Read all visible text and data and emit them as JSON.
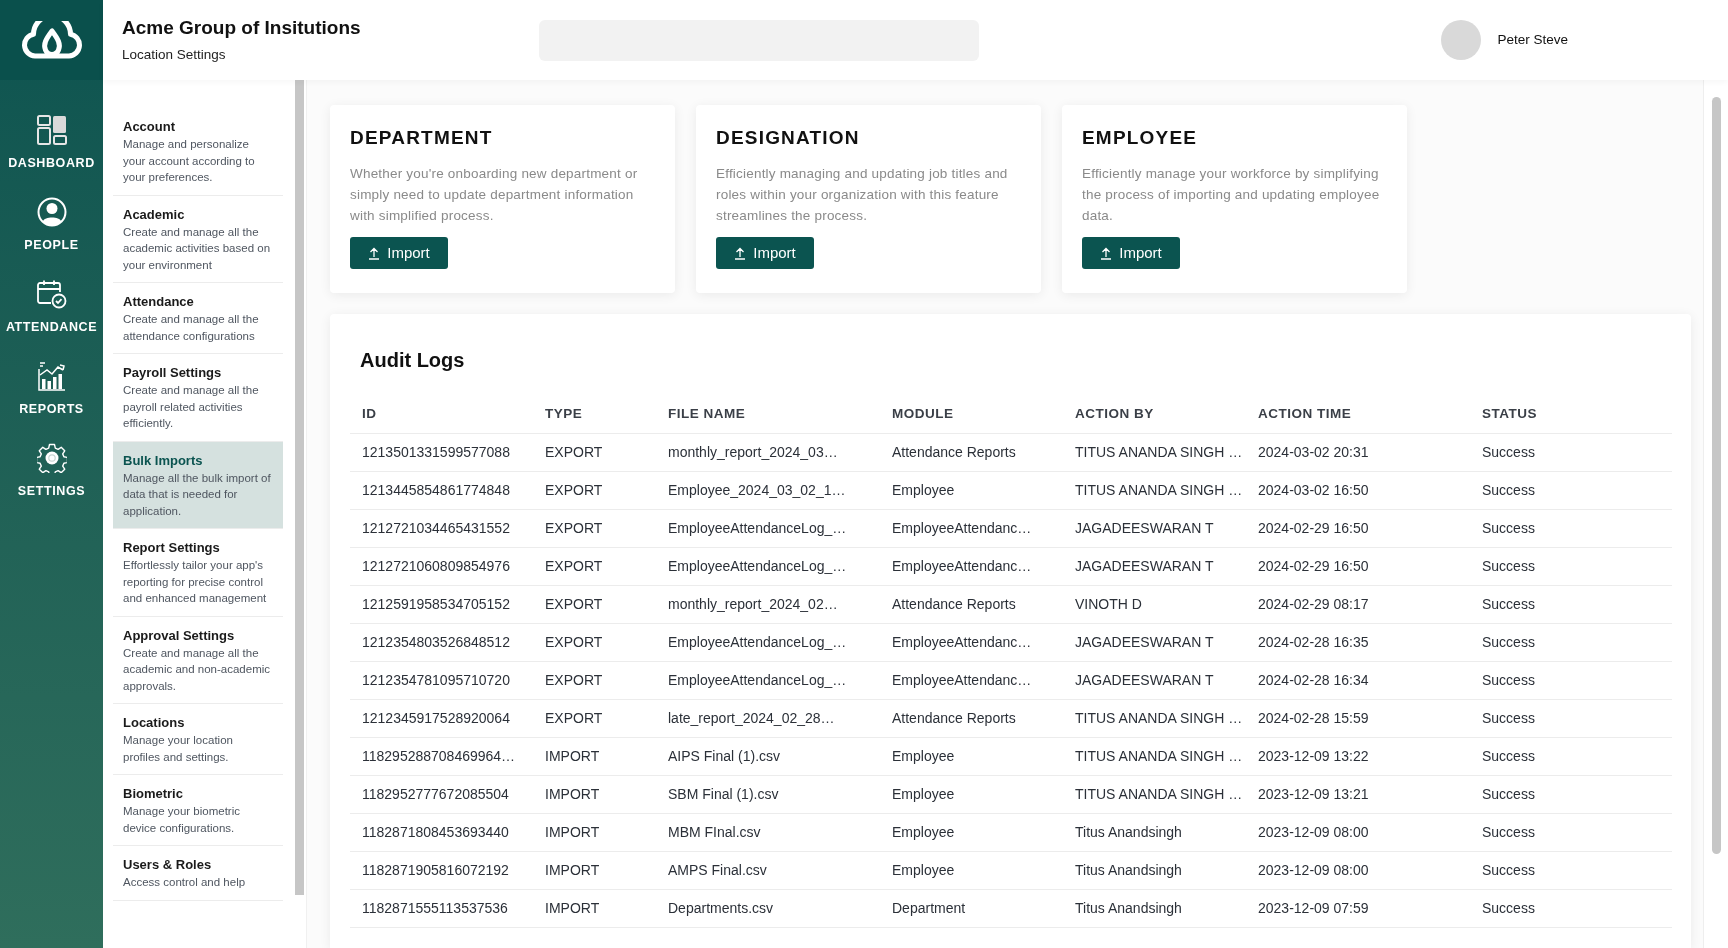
{
  "nav_rail": {
    "items": [
      {
        "label": "DASHBOARD"
      },
      {
        "label": "PEOPLE"
      },
      {
        "label": "ATTENDANCE"
      },
      {
        "label": "REPORTS"
      },
      {
        "label": "SETTINGS"
      }
    ]
  },
  "header": {
    "title": "Acme Group of Insitutions",
    "subtitle": "Location Settings",
    "user_name": "Peter Steve"
  },
  "settings_menu": {
    "items": [
      {
        "title": "Account",
        "description": "Manage and personalize your account according to your preferences.",
        "selected": false
      },
      {
        "title": "Academic",
        "description": "Create and manage all the academic activities based on your environment",
        "selected": false
      },
      {
        "title": "Attendance",
        "description": "Create and manage all the attendance configurations",
        "selected": false
      },
      {
        "title": "Payroll Settings",
        "description": "Create and manage all the payroll related activities efficiently.",
        "selected": false
      },
      {
        "title": "Bulk Imports",
        "description": "Manage all the bulk import of data that is needed for application.",
        "selected": true
      },
      {
        "title": "Report Settings",
        "description": "Effortlessly tailor your app's reporting for precise control and enhanced management",
        "selected": false
      },
      {
        "title": "Approval Settings",
        "description": "Create and manage all the academic and non-academic approvals.",
        "selected": false
      },
      {
        "title": "Locations",
        "description": "Manage your location profiles and settings.",
        "selected": false
      },
      {
        "title": "Biometric",
        "description": "Manage your biometric device configurations.",
        "selected": false
      },
      {
        "title": "Users & Roles",
        "description": "Access control and help",
        "selected": false
      }
    ]
  },
  "import_cards": [
    {
      "title": "DEPARTMENT",
      "description": "Whether you're onboarding new department or simply need to update department information with simplified process.",
      "button": "Import"
    },
    {
      "title": "DESIGNATION",
      "description": "Efficiently managing and updating job titles and roles within your organization with this feature streamlines the process.",
      "button": "Import"
    },
    {
      "title": "EMPLOYEE",
      "description": "Efficiently manage your workforce by simplifying the process of importing and updating employee data.",
      "button": "Import"
    }
  ],
  "audit_logs": {
    "title": "Audit Logs",
    "columns": [
      "ID",
      "TYPE",
      "FILE NAME",
      "MODULE",
      "ACTION BY",
      "ACTION TIME",
      "STATUS"
    ],
    "rows": [
      [
        "1213501331599577088",
        "EXPORT",
        "monthly_report_2024_03…",
        "Attendance Reports",
        "TITUS ANANDA SINGH …",
        "2024-03-02 20:31",
        "Success"
      ],
      [
        "1213445854861774848",
        "EXPORT",
        "Employee_2024_03_02_1…",
        "Employee",
        "TITUS ANANDA SINGH …",
        "2024-03-02 16:50",
        "Success"
      ],
      [
        "1212721034465431552",
        "EXPORT",
        "EmployeeAttendanceLog_…",
        "EmployeeAttendanc…",
        "JAGADEESWARAN T",
        "2024-02-29 16:50",
        "Success"
      ],
      [
        "1212721060809854976",
        "EXPORT",
        "EmployeeAttendanceLog_…",
        "EmployeeAttendanc…",
        "JAGADEESWARAN T",
        "2024-02-29 16:50",
        "Success"
      ],
      [
        "1212591958534705152",
        "EXPORT",
        "monthly_report_2024_02…",
        "Attendance Reports",
        "VINOTH D",
        "2024-02-29 08:17",
        "Success"
      ],
      [
        "1212354803526848512",
        "EXPORT",
        "EmployeeAttendanceLog_…",
        "EmployeeAttendanc…",
        "JAGADEESWARAN T",
        "2024-02-28 16:35",
        "Success"
      ],
      [
        "1212354781095710720",
        "EXPORT",
        "EmployeeAttendanceLog_…",
        "EmployeeAttendanc…",
        "JAGADEESWARAN T",
        "2024-02-28 16:34",
        "Success"
      ],
      [
        "1212345917528920064",
        "EXPORT",
        "late_report_2024_02_28…",
        "Attendance Reports",
        "TITUS ANANDA SINGH …",
        "2024-02-28 15:59",
        "Success"
      ],
      [
        "118295288708469964…",
        "IMPORT",
        "AIPS Final (1).csv",
        "Employee",
        "TITUS ANANDA SINGH …",
        "2023-12-09 13:22",
        "Success"
      ],
      [
        "1182952777672085504",
        "IMPORT",
        "SBM Final (1).csv",
        "Employee",
        "TITUS ANANDA SINGH …",
        "2023-12-09 13:21",
        "Success"
      ],
      [
        "1182871808453693440",
        "IMPORT",
        "MBM FInal.csv",
        "Employee",
        "Titus Anandsingh",
        "2023-12-09 08:00",
        "Success"
      ],
      [
        "1182871905816072192",
        "IMPORT",
        "AMPS Final.csv",
        "Employee",
        "Titus Anandsingh",
        "2023-12-09 08:00",
        "Success"
      ],
      [
        "1182871555113537536",
        "IMPORT",
        "Departments.csv",
        "Department",
        "Titus Anandsingh",
        "2023-12-09 07:59",
        "Success"
      ]
    ]
  }
}
